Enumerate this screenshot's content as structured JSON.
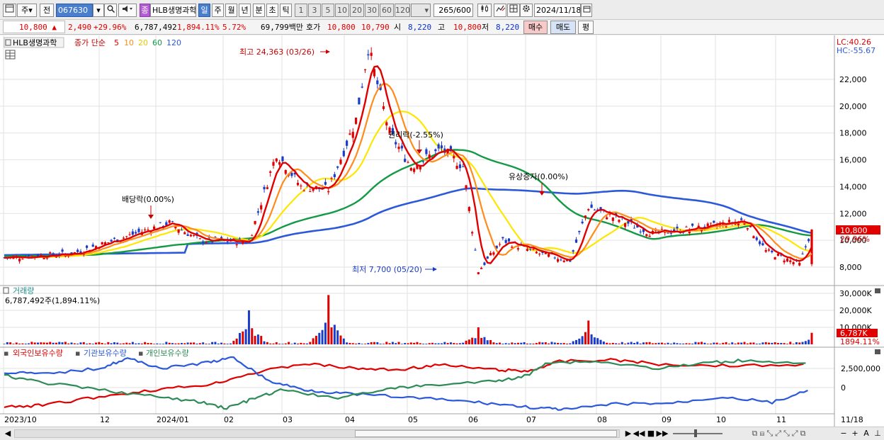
{
  "toolbar": {
    "layout_icon": "window-icon",
    "order_type": "주",
    "prev_label": "전",
    "stock_code": "067630",
    "sound_icon": "speaker-icon",
    "stock_badge": "종",
    "stock_name": "HLB생명과학",
    "periods": [
      "일",
      "주",
      "월",
      "년",
      "분",
      "초",
      "틱"
    ],
    "active_period": "일",
    "intervals": [
      "1",
      "3",
      "5",
      "10",
      "20",
      "30",
      "60",
      "120"
    ],
    "count": "265",
    "count_total": "/600",
    "date": "2024/11/18"
  },
  "quote": {
    "price": "10,800",
    "arrow": "▲",
    "change": "2,490",
    "change_pct": "+29.96%",
    "volume": "6,787,492",
    "volume_ratio": "1,894.11%",
    "turnover": "5.72%",
    "amount": "69,799백만",
    "bid_label": "호가",
    "ask": "10,800",
    "bid": "10,790",
    "open_label": "시",
    "open": "8,220",
    "high_label": "고",
    "high": "10,800",
    "low_label": "저",
    "low": "8,220",
    "buy_btn": "매수",
    "sell_btn": "매도",
    "eval_btn": "평"
  },
  "price_panel": {
    "stock_name": "HLB생명과학",
    "legend_prefix": "종가 단순",
    "ma_labels": [
      "5",
      "10",
      "20",
      "60",
      "120"
    ],
    "ma_colors": [
      "#e00000",
      "#ff8c1a",
      "#ffe600",
      "#139a43",
      "#2b59d9"
    ],
    "lc": "LC:40.26",
    "hc": "HC:-55.67",
    "yticks": [
      "22,000",
      "20,000",
      "18,000",
      "16,000",
      "14,000",
      "12,000",
      "10,000",
      "8,000"
    ],
    "current_price_tag": "10,800",
    "current_pct_tag": "29.96%",
    "annotations": {
      "high": "최고 24,363 (03/26)",
      "low": "최저 7,700 (05/20)",
      "rights": "권리락(-2.55%)",
      "dividend": "배당락(0.00%)",
      "capital_increase": "유상증자(0.00%)"
    }
  },
  "volume_panel": {
    "title": "거래량",
    "info": "6,787,492주(1,894.11%)",
    "yticks": [
      "30,000K",
      "20,000K",
      "10,000K"
    ],
    "volume_tag": "6,787K",
    "ratio_tag": "1894.11%"
  },
  "holdings_panel": {
    "legend": [
      "외국인보유수량",
      "기관보유수량",
      "개인보유수량"
    ],
    "legend_colors": [
      "#e00000",
      "#2b59d9",
      "#2e8b57"
    ],
    "yticks": [
      "2,500,000",
      "0"
    ]
  },
  "x_axis": [
    "2023/10",
    "12",
    "2024/01",
    "02",
    "03",
    "04",
    "05",
    "06",
    "07",
    "08",
    "09",
    "10",
    "11",
    "11/18"
  ],
  "chart_data": {
    "type": "candlestick",
    "title": "HLB생명과학",
    "x_range": [
      "2023/10",
      "2024/11/18"
    ],
    "y_range": [
      7500,
      25000
    ],
    "close_path": [
      {
        "date": "2023/10",
        "close": 8700
      },
      {
        "date": "2023/11",
        "close": 9000
      },
      {
        "date": "2023/12/22",
        "close": 11300
      },
      {
        "date": "2024/01",
        "close": 10000
      },
      {
        "date": "2024/01/31",
        "close": 9900
      },
      {
        "date": "2024/02/08",
        "close": 16500
      },
      {
        "date": "2024/02/20",
        "close": 14000
      },
      {
        "date": "2024/03/05",
        "close": 13800
      },
      {
        "date": "2024/03/20",
        "close": 19000
      },
      {
        "date": "2024/03/26",
        "close": 24363
      },
      {
        "date": "2024/04/05",
        "close": 18000
      },
      {
        "date": "2024/04/15",
        "close": 15500
      },
      {
        "date": "2024/04/30",
        "close": 16800
      },
      {
        "date": "2024/05/10",
        "close": 15500
      },
      {
        "date": "2024/05/20",
        "close": 7700
      },
      {
        "date": "2024/05/31",
        "close": 10000
      },
      {
        "date": "2024/06/15",
        "close": 9000
      },
      {
        "date": "2024/07/01",
        "close": 8500
      },
      {
        "date": "2024/07/10",
        "close": 12500
      },
      {
        "date": "2024/08",
        "close": 10500
      },
      {
        "date": "2024/09",
        "close": 11000
      },
      {
        "date": "2024/09/20",
        "close": 11500
      },
      {
        "date": "2024/10/10",
        "close": 9200
      },
      {
        "date": "2024/11/08",
        "close": 8200
      },
      {
        "date": "2024/11/18",
        "close": 10800
      }
    ],
    "volume_spikes_k": [
      {
        "date": "2024/02/08",
        "volume": 20000
      },
      {
        "date": "2024/03/26",
        "volume": 29000
      },
      {
        "date": "2024/05/20",
        "volume": 10000
      },
      {
        "date": "2024/07/10",
        "volume": 14000
      },
      {
        "date": "2024/11/18",
        "volume": 6787
      }
    ],
    "moving_averages": [
      "5",
      "10",
      "20",
      "60",
      "120"
    ]
  },
  "statusbar": {
    "left_arrow": "◀",
    "right_arrow": "▶",
    "first": "◀◀",
    "stop": "■",
    "last": "▶▶",
    "zoom_out": "−",
    "zoom_in": "+",
    "font": "A"
  }
}
